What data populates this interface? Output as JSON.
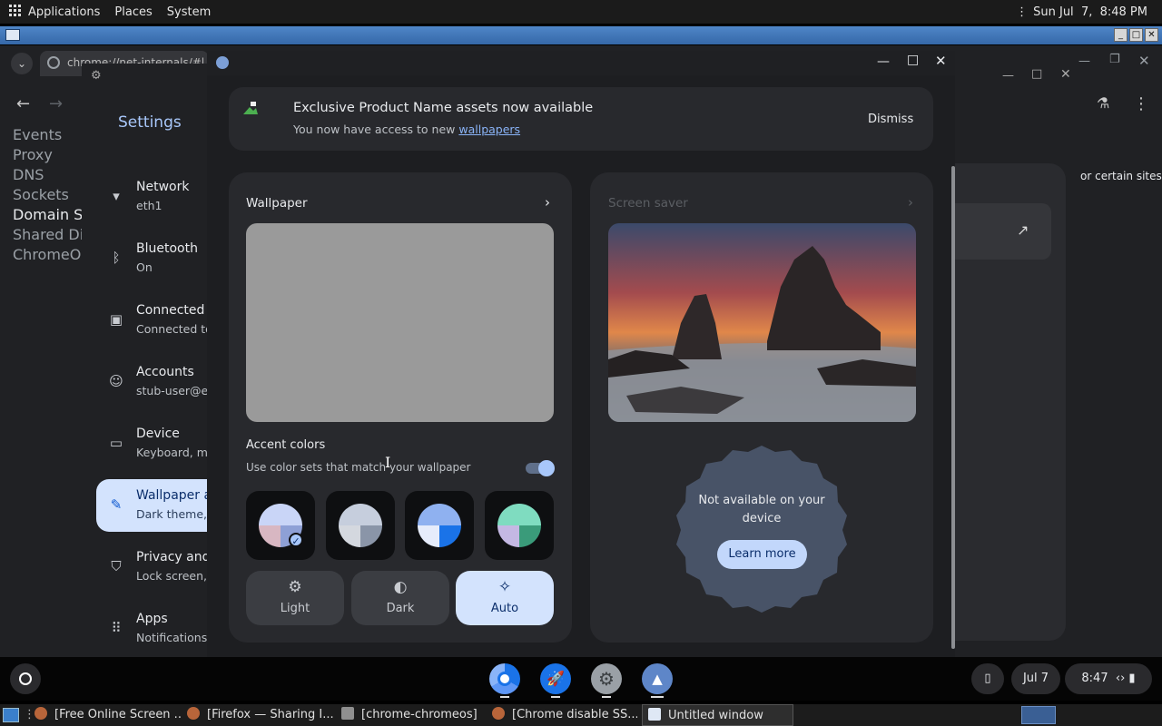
{
  "topbar": {
    "menus": [
      "Applications",
      "Places",
      "System"
    ],
    "clock": "Sun Jul  7,  8:48 PM"
  },
  "chrome": {
    "tab_text": "chrome://net-internals/#hsts",
    "side_items": [
      "Events",
      "Proxy",
      "DNS",
      "Sockets",
      "Domain Se",
      "Shared Dic",
      "ChromeOS"
    ],
    "side_selected": "Domain Se",
    "right_text": "or certain sites"
  },
  "settings": {
    "title": "Settings",
    "nav": [
      {
        "label": "Network",
        "sub": "eth1",
        "icon": "wifi-icon"
      },
      {
        "label": "Bluetooth",
        "sub": "On",
        "icon": "bluetooth-icon"
      },
      {
        "label": "Connected d",
        "sub": "Connected to",
        "icon": "connected-devices-icon"
      },
      {
        "label": "Accounts",
        "sub": "stub-user@ex",
        "icon": "accounts-icon"
      },
      {
        "label": "Device",
        "sub": "Keyboard, mo",
        "icon": "laptop-icon"
      },
      {
        "label": "Wallpaper ar",
        "sub": "Dark theme, s",
        "icon": "brush-icon",
        "active": true
      },
      {
        "label": "Privacy and",
        "sub": "Lock screen,",
        "icon": "shield-icon"
      },
      {
        "label": "Apps",
        "sub": "Notifications",
        "icon": "apps-grid-icon"
      }
    ]
  },
  "personalization": {
    "banner": {
      "title": "Exclusive Product Name assets now available",
      "text_prefix": "You now have access to new ",
      "link": "wallpapers",
      "dismiss": "Dismiss"
    },
    "wallpaper": {
      "heading": "Wallpaper"
    },
    "accent": {
      "heading": "Accent colors",
      "toggle_label": "Use color sets that match your wallpaper",
      "toggle_on": true,
      "swatches": [
        {
          "colors": [
            "#c9d5f7",
            "#d8b7c2",
            "#8ea0d6"
          ],
          "selected": true
        },
        {
          "colors": [
            "#c6cedd",
            "#d4d8df",
            "#8a95a8"
          ],
          "selected": false
        },
        {
          "colors": [
            "#8fb1f0",
            "#e6ecfb",
            "#1a73e8"
          ],
          "selected": false
        },
        {
          "colors": [
            "#7fdcc0",
            "#c4b8e3",
            "#3a9b7a"
          ],
          "selected": false
        }
      ]
    },
    "modes": [
      {
        "label": "Light",
        "icon": "sun-icon",
        "selected": false
      },
      {
        "label": "Dark",
        "icon": "contrast-icon",
        "selected": false
      },
      {
        "label": "Auto",
        "icon": "magic-wand-icon",
        "selected": true
      }
    ],
    "screensaver": {
      "heading": "Screen saver",
      "unavailable": "Not available on your device",
      "learn_more": "Learn more"
    }
  },
  "shelf": {
    "date": "Jul 7",
    "time": "8:47"
  },
  "taskbar": {
    "items": [
      "[Free Online Screen ...",
      "[Firefox — Sharing I...",
      "[chrome-chromeos]",
      "[Chrome disable SS...",
      "Untitled window"
    ]
  }
}
